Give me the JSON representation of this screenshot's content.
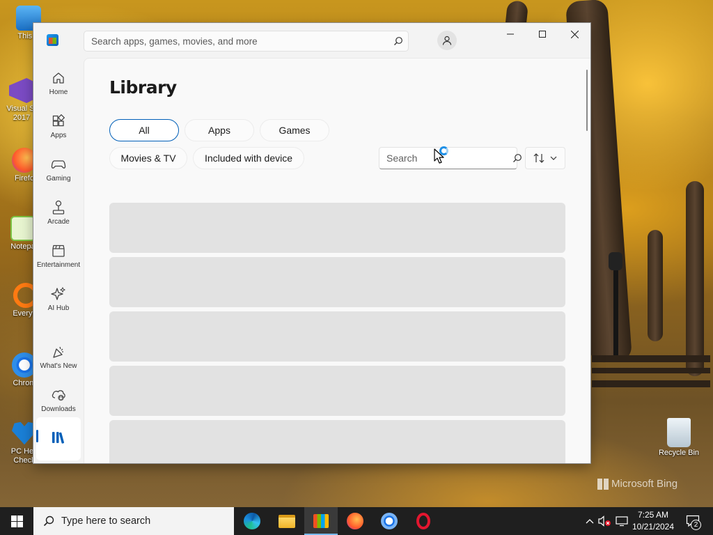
{
  "desktop": {
    "icons": [
      {
        "label": "This P",
        "name": "this-pc"
      },
      {
        "label": "Visual St 2017",
        "name": "visual-studio"
      },
      {
        "label": "Firefo",
        "name": "firefox"
      },
      {
        "label": "Notepa",
        "name": "notepad-plus"
      },
      {
        "label": "Everyth",
        "name": "everything"
      },
      {
        "label": "Chrom",
        "name": "chrome"
      },
      {
        "label": "PC Hea Check",
        "name": "pc-health-check"
      }
    ],
    "recycle_bin_label": "Recycle Bin",
    "watermark": "Microsoft Bing"
  },
  "store": {
    "search_placeholder": "Search apps, games, movies, and more",
    "nav": [
      {
        "label": "Home",
        "icon": "home-icon"
      },
      {
        "label": "Apps",
        "icon": "apps-icon"
      },
      {
        "label": "Gaming",
        "icon": "gamepad-icon"
      },
      {
        "label": "Arcade",
        "icon": "joystick-icon"
      },
      {
        "label": "Entertainment",
        "icon": "clapperboard-icon"
      },
      {
        "label": "AI Hub",
        "icon": "sparkle-icon"
      },
      {
        "label": "What's New",
        "icon": "party-icon"
      },
      {
        "label": "Downloads",
        "icon": "download-cloud-icon"
      },
      {
        "label": "Library",
        "icon": "library-icon"
      }
    ],
    "library": {
      "title": "Library",
      "filters": [
        "All",
        "Apps",
        "Games",
        "Movies & TV",
        "Included with device"
      ],
      "selected_filter": "All",
      "search_placeholder": "Search",
      "skeleton_rows": 6
    }
  },
  "taskbar": {
    "search_placeholder": "Type here to search",
    "apps": [
      "edge",
      "file-explorer",
      "microsoft-store",
      "firefox",
      "chrome",
      "opera"
    ],
    "active_app": "microsoft-store",
    "time": "7:25 AM",
    "date": "10/21/2024",
    "notification_count": "2"
  },
  "colors": {
    "accent": "#005fb8",
    "skeleton": "#e2e2e2",
    "taskbar": "#1f1f1f"
  }
}
